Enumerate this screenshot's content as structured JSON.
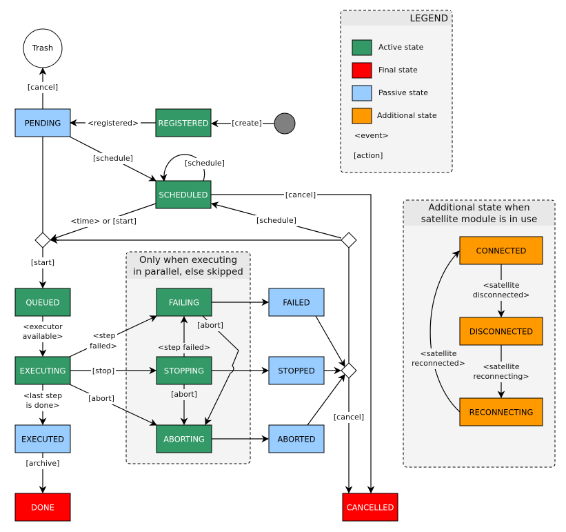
{
  "colors": {
    "active": "#339966",
    "final": "#ff0000",
    "passive": "#99ccff",
    "additional": "#ff9900",
    "initial": "#808080"
  },
  "legend": {
    "title": "LEGEND",
    "items": [
      {
        "label": "Active state",
        "color": "#339966"
      },
      {
        "label": "Final state",
        "color": "#ff0000"
      },
      {
        "label": "Passive state",
        "color": "#99ccff"
      },
      {
        "label": "Additional state",
        "color": "#ff9900"
      }
    ],
    "event": "<event>",
    "action": "[action]"
  },
  "groups": {
    "parallel": [
      "Only when executing",
      "in parallel, else skipped"
    ],
    "satellite": [
      "Additional state when",
      "satellite module is in use"
    ]
  },
  "states": {
    "trash": "Trash",
    "pending": "PENDING",
    "registered": "REGISTERED",
    "scheduled": "SCHEDULED",
    "queued": "QUEUED",
    "executing": "EXECUTING",
    "executed": "EXECUTED",
    "done": "DONE",
    "failing": "FAILING",
    "stopping": "STOPPING",
    "aborting": "ABORTING",
    "failed": "FAILED",
    "stopped": "STOPPED",
    "aborted": "ABORTED",
    "cancelled": "CANCELLED",
    "connected": "CONNECTED",
    "disconnected": "DISCONNECTED",
    "reconnecting": "RECONNECTING"
  },
  "transitions": {
    "pending_trash": "[cancel]",
    "registered_pending": "<registered>",
    "init_registered": "[create]",
    "pending_scheduled": "[schedule]",
    "scheduled_self": "[schedule]",
    "scheduled_cancel": "[cancel]",
    "scheduled_start": "<time> or [start]",
    "decision_scheduled": "[schedule]",
    "decision_queued": "[start]",
    "queued_executing": [
      "<executor",
      "available>"
    ],
    "executing_failing": [
      "<step",
      "failed>"
    ],
    "executing_stopping": "[stop]",
    "executing_aborting": "[abort]",
    "stopping_failing": "<step failed>",
    "stopping_aborting": "[abort]",
    "failing_aborting": "[abort]",
    "final_cancel": "[cancel]",
    "executing_executed": [
      "<last step",
      "is done>"
    ],
    "executed_done": "[archive]",
    "connected_disconnected": [
      "<satellite",
      "disconnected>"
    ],
    "disconnected_reconnecting": [
      "<satellite",
      "reconnecting>"
    ],
    "reconnecting_connected": [
      "<satellite",
      "reconnected>"
    ]
  }
}
